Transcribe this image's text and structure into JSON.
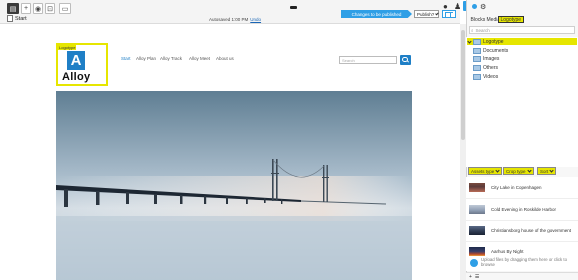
{
  "toolbar": {
    "start_label": "Start",
    "autosave_text": "Autosaved 1:00 PM",
    "undo_label": "Undo",
    "changes_label": "Changes to be published",
    "publish_label": "Publish?"
  },
  "logo": {
    "tag": "Logotype",
    "letter": "A",
    "word": "Alloy"
  },
  "nav": [
    "Start",
    "Alloy Plan",
    "Alloy Track",
    "Alloy Meet",
    "About us"
  ],
  "site_search": {
    "placeholder": "Search"
  },
  "panel": {
    "tabs": [
      "Blocks",
      "Media",
      "Logotype"
    ],
    "search_placeholder": "Search",
    "tree_root": "Logotype",
    "tree": [
      "Documents",
      "Images",
      "Others",
      "Videos"
    ],
    "filters": [
      "Assets type",
      "Crop type",
      "Sort"
    ],
    "assets": [
      "City Lake in Copenhagen",
      "Cold Evening in Roskilde Harbor",
      "Christiansborg house of the government",
      "Aarhus By Night"
    ],
    "upload_text": "Upload files by dragging them here or click to browse",
    "footer_plus": "+"
  },
  "colors": {
    "highlight": "#e6e600",
    "accent": "#2f9fe6",
    "brand": "#1f7fc6"
  }
}
